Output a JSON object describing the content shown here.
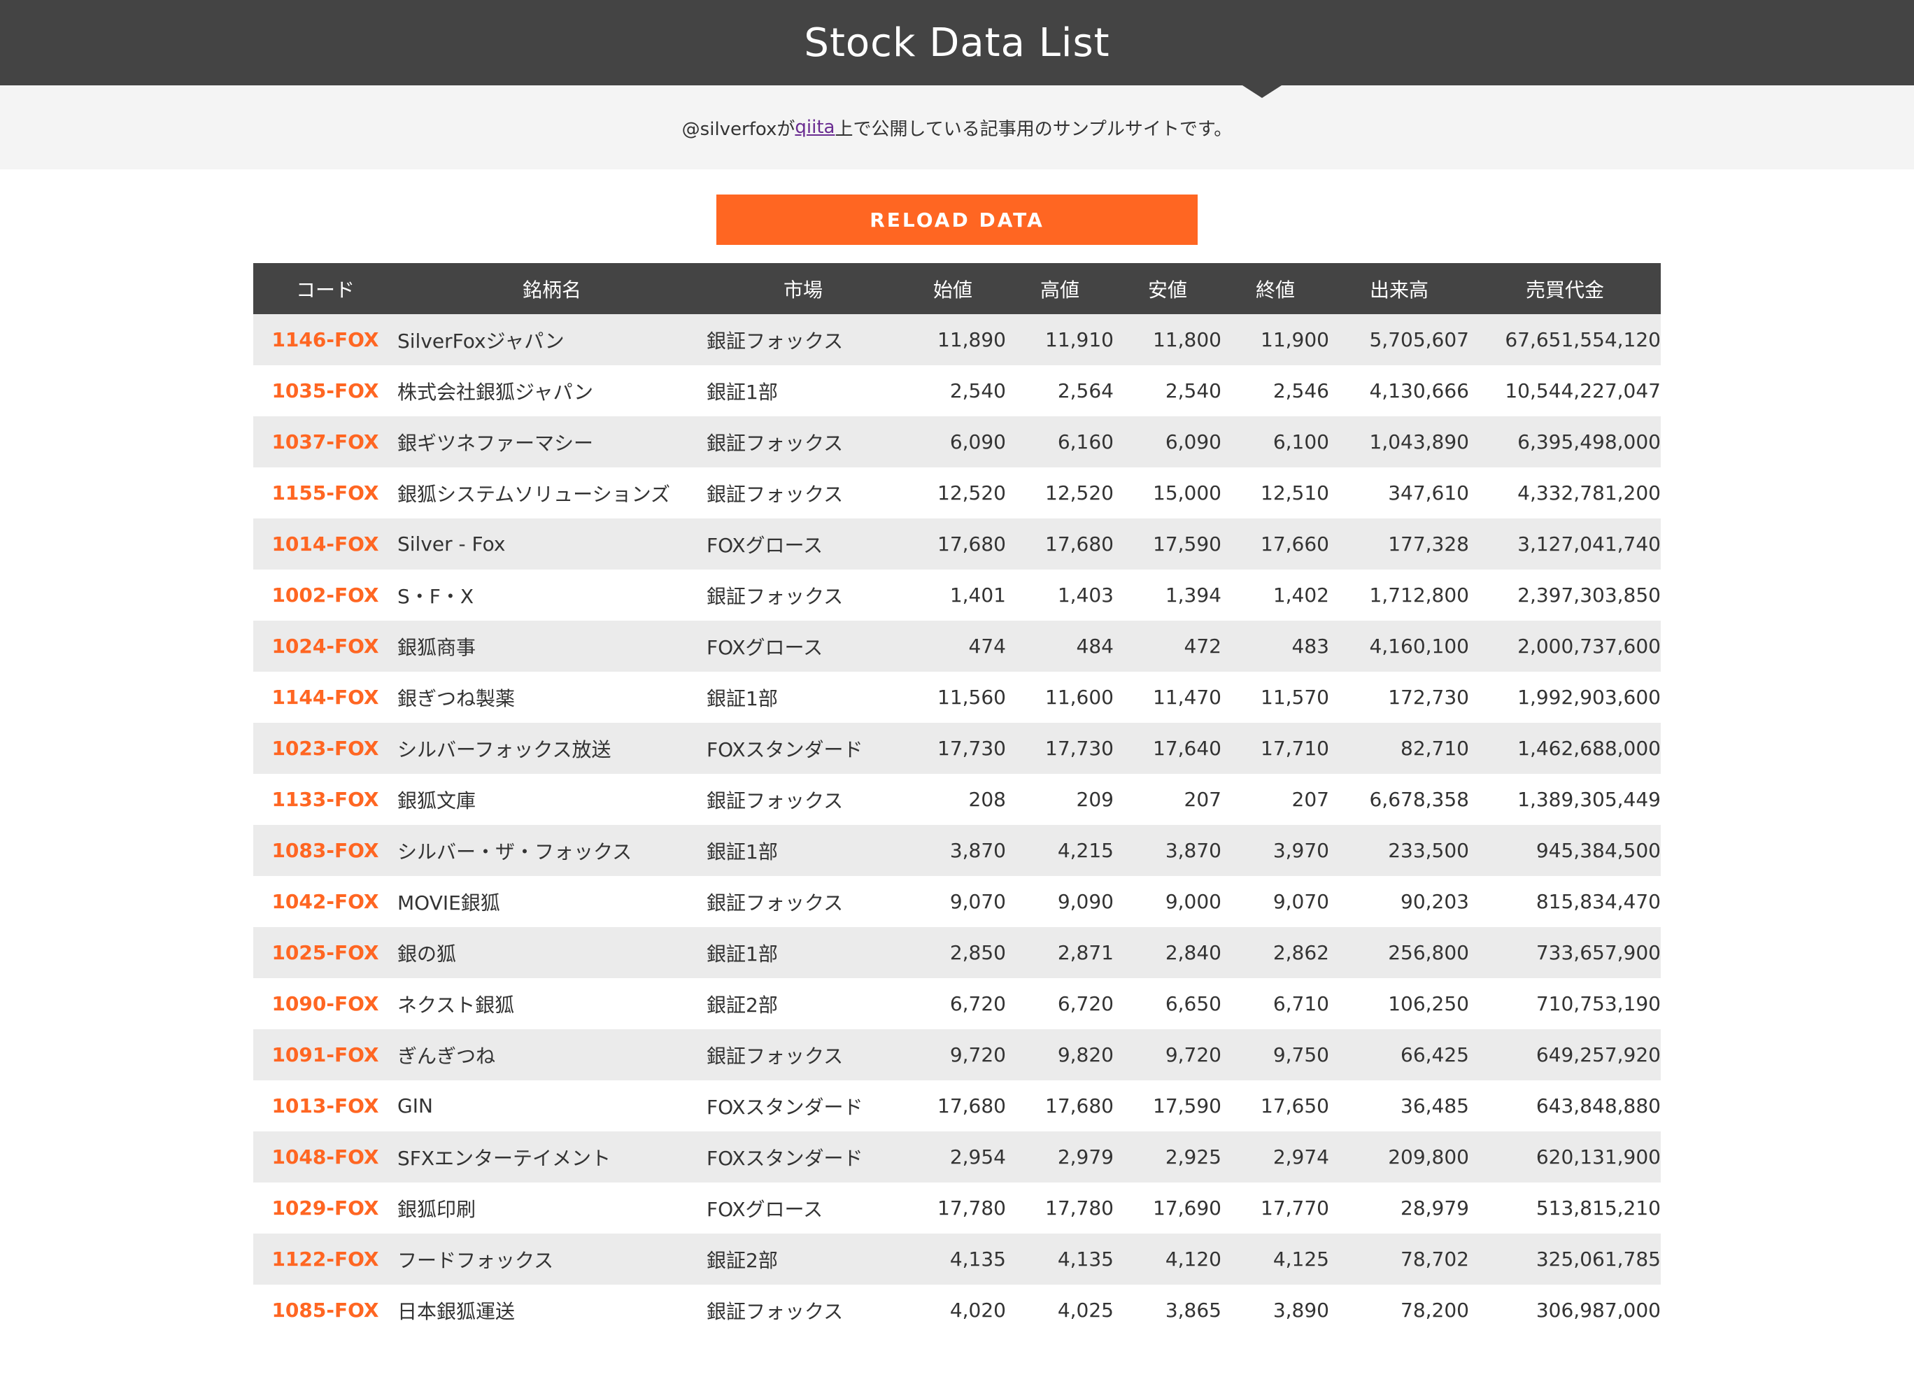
{
  "header": {
    "title": "Stock Data List"
  },
  "subtitle": {
    "prefix": "@silverfoxが",
    "link": "qiita",
    "suffix": "上で公開している記事用のサンプルサイトです。"
  },
  "reload_button": {
    "label": "RELOAD DATA"
  },
  "colors": {
    "header_bg": "#444444",
    "accent": "#ff6622",
    "row_alt": "#ebebeb"
  },
  "table": {
    "columns": [
      "コード",
      "銘柄名",
      "市場",
      "始値",
      "高値",
      "安値",
      "終値",
      "出来高",
      "売買代金"
    ],
    "rows": [
      [
        "1146-FOX",
        "SilverFoxジャパン",
        "銀証フォックス",
        "11,890",
        "11,910",
        "11,800",
        "11,900",
        "5,705,607",
        "67,651,554,120"
      ],
      [
        "1035-FOX",
        "株式会社銀狐ジャパン",
        "銀証1部",
        "2,540",
        "2,564",
        "2,540",
        "2,546",
        "4,130,666",
        "10,544,227,047"
      ],
      [
        "1037-FOX",
        "銀ギツネファーマシー",
        "銀証フォックス",
        "6,090",
        "6,160",
        "6,090",
        "6,100",
        "1,043,890",
        "6,395,498,000"
      ],
      [
        "1155-FOX",
        "銀狐システムソリューションズ",
        "銀証フォックス",
        "12,520",
        "12,520",
        "15,000",
        "12,510",
        "347,610",
        "4,332,781,200"
      ],
      [
        "1014-FOX",
        "Silver - Fox",
        "FOXグロース",
        "17,680",
        "17,680",
        "17,590",
        "17,660",
        "177,328",
        "3,127,041,740"
      ],
      [
        "1002-FOX",
        "S・F・X",
        "銀証フォックス",
        "1,401",
        "1,403",
        "1,394",
        "1,402",
        "1,712,800",
        "2,397,303,850"
      ],
      [
        "1024-FOX",
        "銀狐商事",
        "FOXグロース",
        "474",
        "484",
        "472",
        "483",
        "4,160,100",
        "2,000,737,600"
      ],
      [
        "1144-FOX",
        "銀ぎつね製薬",
        "銀証1部",
        "11,560",
        "11,600",
        "11,470",
        "11,570",
        "172,730",
        "1,992,903,600"
      ],
      [
        "1023-FOX",
        "シルバーフォックス放送",
        "FOXスタンダード",
        "17,730",
        "17,730",
        "17,640",
        "17,710",
        "82,710",
        "1,462,688,000"
      ],
      [
        "1133-FOX",
        "銀狐文庫",
        "銀証フォックス",
        "208",
        "209",
        "207",
        "207",
        "6,678,358",
        "1,389,305,449"
      ],
      [
        "1083-FOX",
        "シルバー・ザ・フォックス",
        "銀証1部",
        "3,870",
        "4,215",
        "3,870",
        "3,970",
        "233,500",
        "945,384,500"
      ],
      [
        "1042-FOX",
        "MOVIE銀狐",
        "銀証フォックス",
        "9,070",
        "9,090",
        "9,000",
        "9,070",
        "90,203",
        "815,834,470"
      ],
      [
        "1025-FOX",
        "銀の狐",
        "銀証1部",
        "2,850",
        "2,871",
        "2,840",
        "2,862",
        "256,800",
        "733,657,900"
      ],
      [
        "1090-FOX",
        "ネクスト銀狐",
        "銀証2部",
        "6,720",
        "6,720",
        "6,650",
        "6,710",
        "106,250",
        "710,753,190"
      ],
      [
        "1091-FOX",
        "ぎんぎつね",
        "銀証フォックス",
        "9,720",
        "9,820",
        "9,720",
        "9,750",
        "66,425",
        "649,257,920"
      ],
      [
        "1013-FOX",
        "GIN",
        "FOXスタンダード",
        "17,680",
        "17,680",
        "17,590",
        "17,650",
        "36,485",
        "643,848,880"
      ],
      [
        "1048-FOX",
        "SFXエンターテイメント",
        "FOXスタンダード",
        "2,954",
        "2,979",
        "2,925",
        "2,974",
        "209,800",
        "620,131,900"
      ],
      [
        "1029-FOX",
        "銀狐印刷",
        "FOXグロース",
        "17,780",
        "17,780",
        "17,690",
        "17,770",
        "28,979",
        "513,815,210"
      ],
      [
        "1122-FOX",
        "フードフォックス",
        "銀証2部",
        "4,135",
        "4,135",
        "4,120",
        "4,125",
        "78,702",
        "325,061,785"
      ],
      [
        "1085-FOX",
        "日本銀狐運送",
        "銀証フォックス",
        "4,020",
        "4,025",
        "3,865",
        "3,890",
        "78,200",
        "306,987,000"
      ]
    ]
  }
}
